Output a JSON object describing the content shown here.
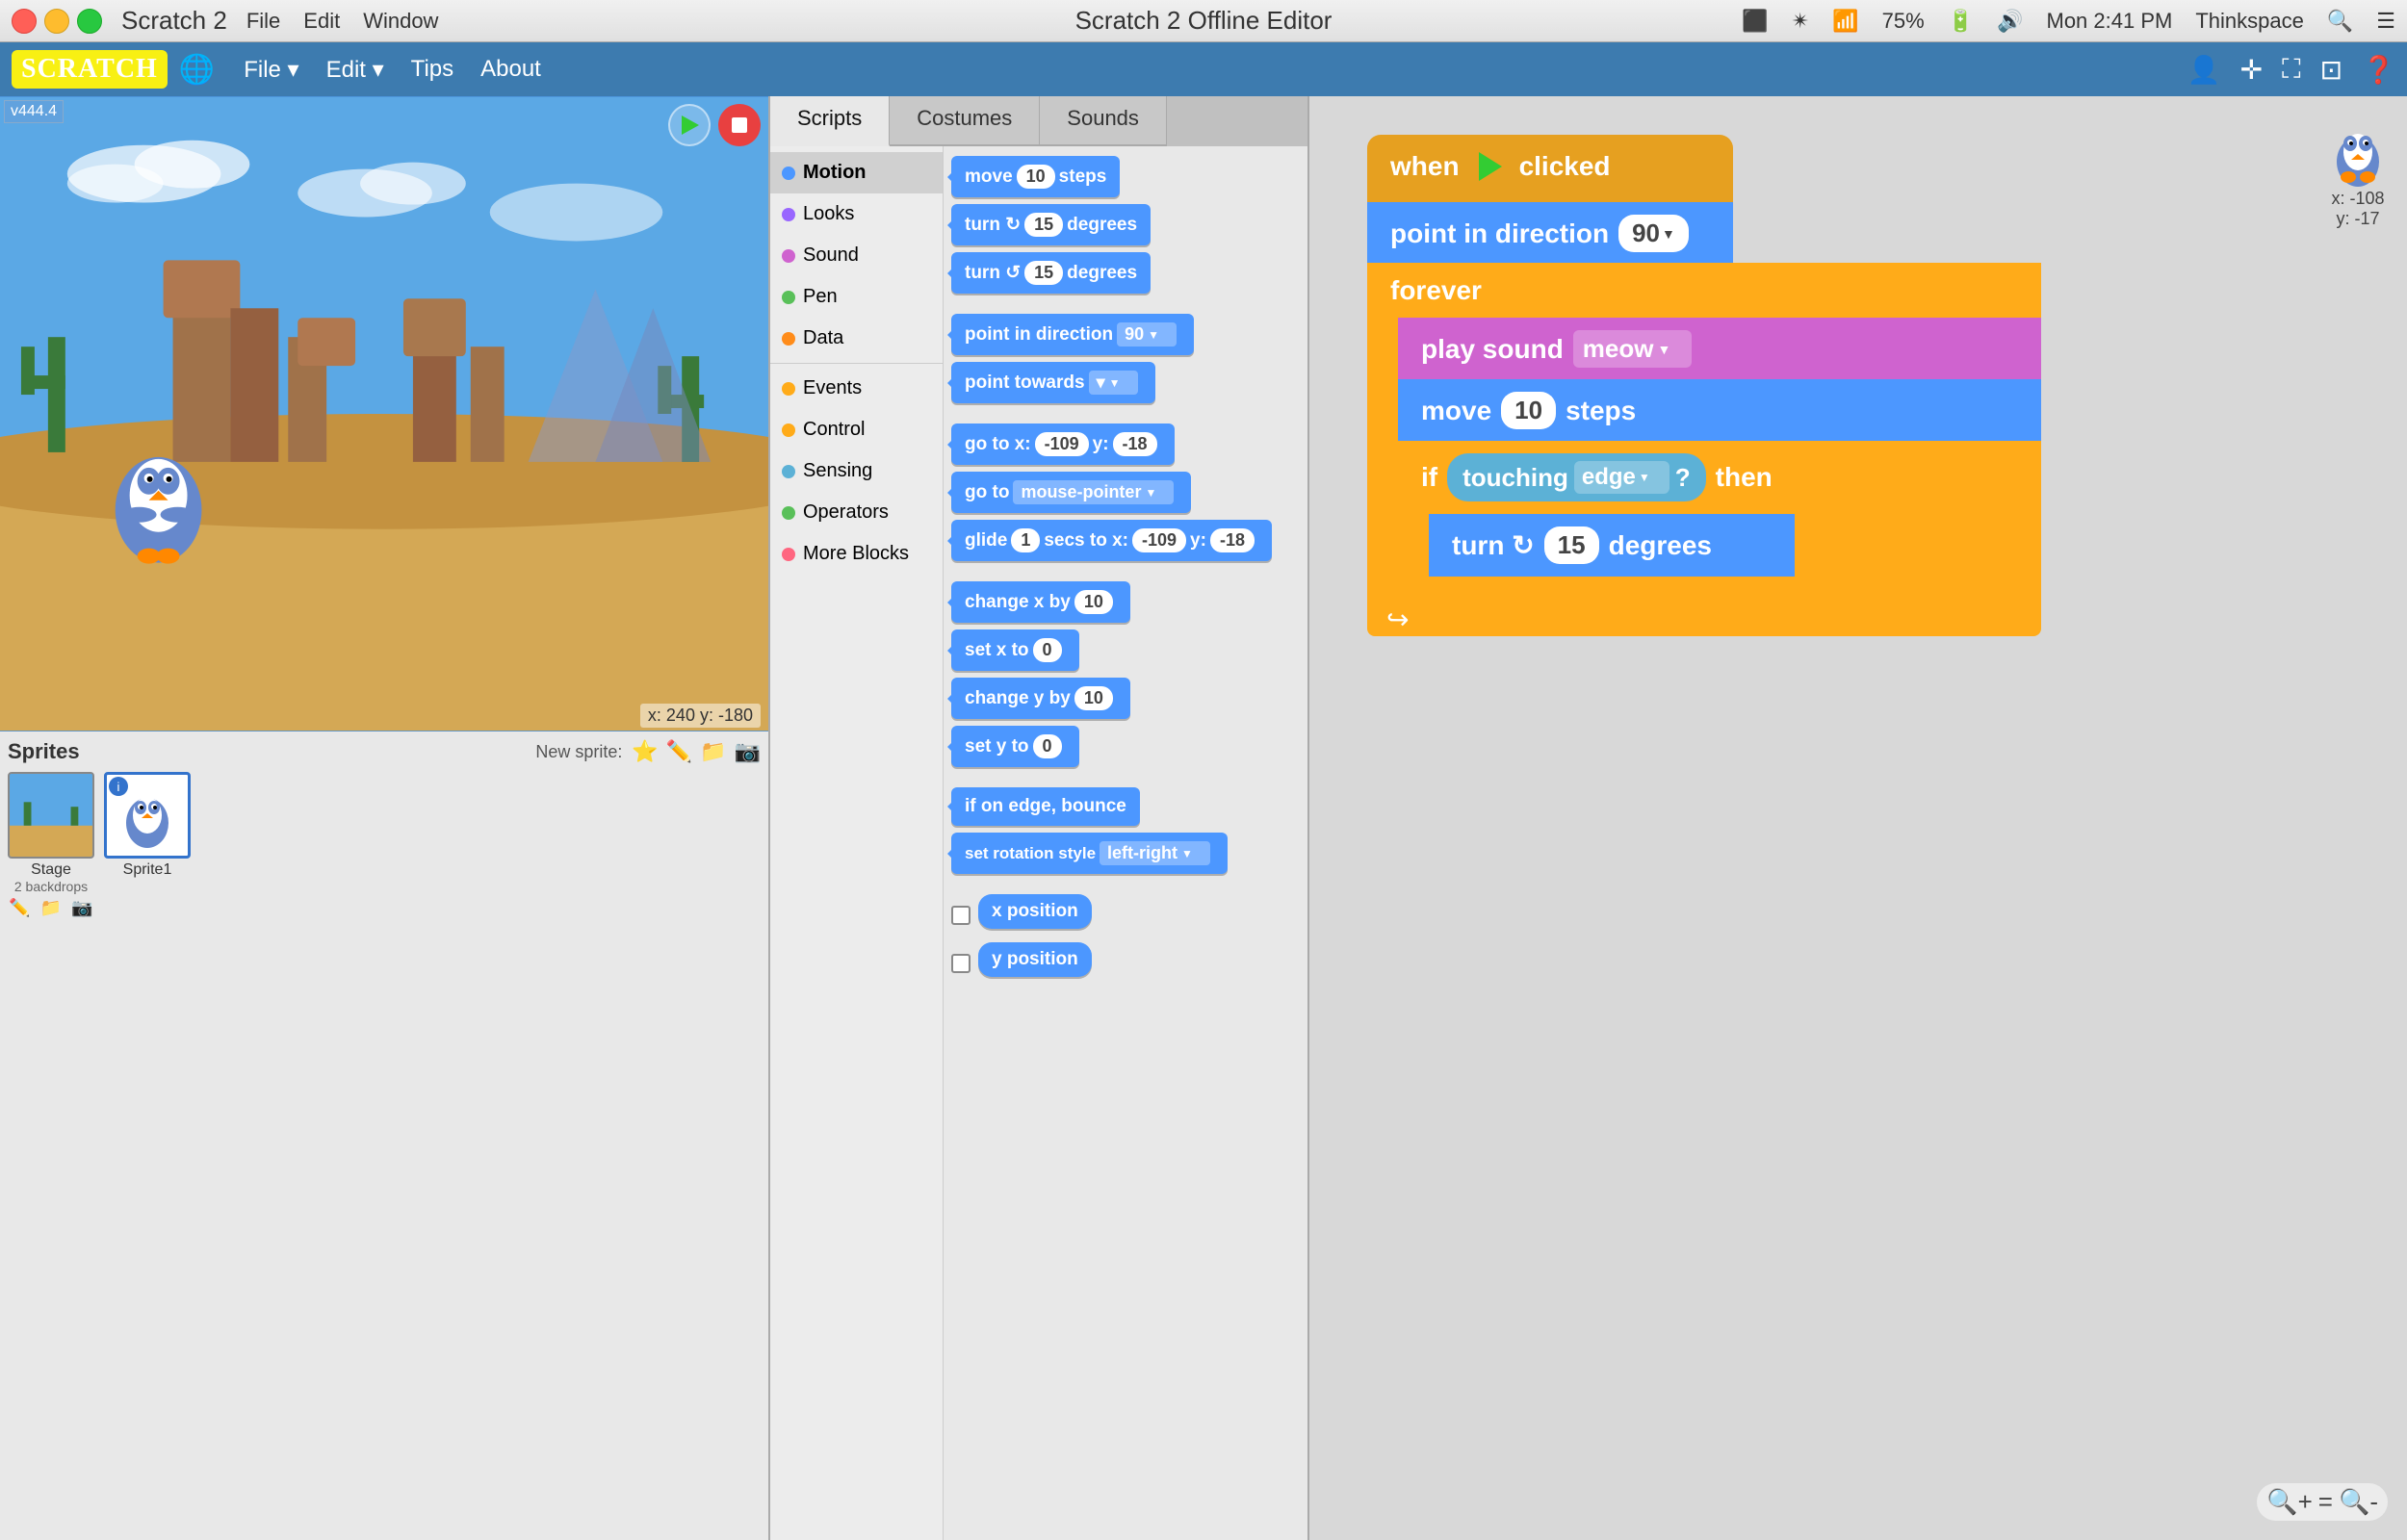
{
  "titlebar": {
    "app_name": "Scratch 2",
    "window_title": "Scratch 2 Offline Editor",
    "time": "Mon 2:41 PM",
    "user": "Thinkspace",
    "battery": "75%",
    "menu_items": [
      "File",
      "Edit",
      "Window"
    ]
  },
  "menubar": {
    "logo": "SCRATCH",
    "items": [
      "File ▾",
      "Edit ▾",
      "Tips",
      "About"
    ]
  },
  "editor": {
    "tabs": [
      "Scripts",
      "Costumes",
      "Sounds"
    ],
    "active_tab": "Scripts"
  },
  "categories": [
    {
      "name": "Motion",
      "color": "#4c97ff"
    },
    {
      "name": "Looks",
      "color": "#9966ff"
    },
    {
      "name": "Sound",
      "color": "#cf63cf"
    },
    {
      "name": "Pen",
      "color": "#59c059"
    },
    {
      "name": "Data",
      "color": "#ff8c1a"
    },
    {
      "name": "Events",
      "color": "#ffab19"
    },
    {
      "name": "Control",
      "color": "#ffab19"
    },
    {
      "name": "Sensing",
      "color": "#5cb1d6"
    },
    {
      "name": "Operators",
      "color": "#59c059"
    },
    {
      "name": "More Blocks",
      "color": "#ff6680"
    }
  ],
  "blocks": [
    {
      "label": "move 10 steps",
      "type": "motion",
      "has_val": true,
      "val": "10"
    },
    {
      "label": "turn ↻ 15 degrees",
      "type": "motion"
    },
    {
      "label": "turn ↺ 15 degrees",
      "type": "motion"
    },
    {
      "label": "point in direction 90 ▾",
      "type": "motion"
    },
    {
      "label": "point towards ▾",
      "type": "motion"
    },
    {
      "label": "go to x: -109 y: -18",
      "type": "motion"
    },
    {
      "label": "go to mouse-pointer ▾",
      "type": "motion"
    },
    {
      "label": "glide 1 secs to x: -109 y: -18",
      "type": "motion"
    },
    {
      "label": "change x by 10",
      "type": "motion"
    },
    {
      "label": "set x to 0",
      "type": "motion"
    },
    {
      "label": "change y by 10",
      "type": "motion"
    },
    {
      "label": "set y to 0",
      "type": "motion"
    },
    {
      "label": "if on edge, bounce",
      "type": "motion"
    },
    {
      "label": "set rotation style left-right ▾",
      "type": "motion"
    },
    {
      "label": "x position",
      "type": "reporter"
    },
    {
      "label": "y position",
      "type": "reporter"
    }
  ],
  "script": {
    "hat": "when 🚩 clicked",
    "blocks": [
      {
        "label": "point in direction",
        "type": "motion",
        "val": "90"
      },
      {
        "label": "forever",
        "type": "control",
        "children": [
          {
            "label": "play sound meow ▾",
            "type": "sound"
          },
          {
            "label": "move 10 steps",
            "type": "motion",
            "val": "10"
          },
          {
            "label": "if touching edge ? then",
            "type": "control",
            "children": [
              {
                "label": "turn ↻ 15 degrees",
                "type": "motion",
                "val": "15"
              }
            ]
          }
        ]
      }
    ]
  },
  "sprites": {
    "title": "Sprites",
    "new_sprite_label": "New sprite:",
    "items": [
      {
        "name": "Stage",
        "sub": "2 backdrops",
        "type": "stage"
      },
      {
        "name": "Sprite1",
        "type": "sprite",
        "selected": true
      }
    ]
  },
  "stage": {
    "coords_display": "x: 240  y: -180",
    "sprite_coords": "x: -108\ny: -17",
    "version_label": "v444.4"
  },
  "zoom": {
    "zoom_in": "+",
    "zoom_reset": "=",
    "zoom_out": "-"
  }
}
